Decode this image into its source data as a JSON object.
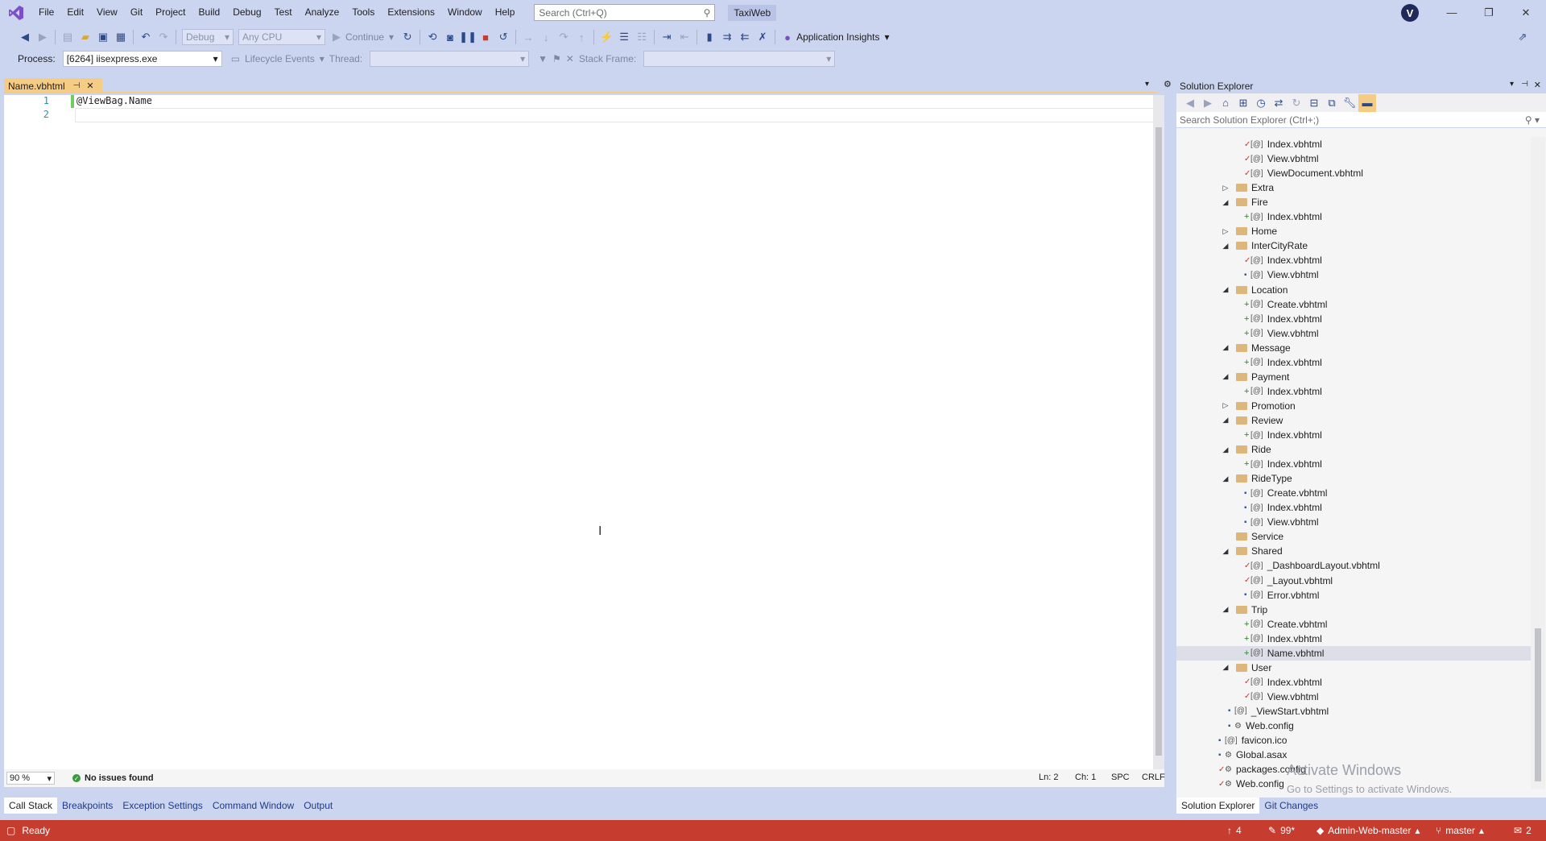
{
  "menubar": {
    "items": [
      "File",
      "Edit",
      "View",
      "Git",
      "Project",
      "Build",
      "Debug",
      "Test",
      "Analyze",
      "Tools",
      "Extensions",
      "Window",
      "Help"
    ],
    "search_placeholder": "Search (Ctrl+Q)",
    "solution_name": "TaxiWeb",
    "avatar_letter": "V"
  },
  "toolbar": {
    "config": "Debug",
    "platform": "Any CPU",
    "continue_label": "Continue",
    "app_insights_label": "Application Insights",
    "process_label": "Process:",
    "process_value": "[6264] iisexpress.exe",
    "lifecycle_label": "Lifecycle Events",
    "thread_label": "Thread:",
    "stack_frame_label": "Stack Frame:"
  },
  "editor": {
    "tab_label": "Name.vbhtml",
    "lines": [
      {
        "number": "1",
        "text": "@ViewBag.Name"
      },
      {
        "number": "2",
        "text": ""
      }
    ],
    "zoom": "90 %",
    "issues": "No issues found",
    "ln": "Ln: 2",
    "ch": "Ch: 1",
    "spc": "SPC",
    "crlf": "CRLF"
  },
  "bottom_tabs": [
    "Call Stack",
    "Breakpoints",
    "Exception Settings",
    "Command Window",
    "Output"
  ],
  "solution_explorer": {
    "title": "Solution Explorer",
    "search_placeholder": "Search Solution Explorer (Ctrl+;)",
    "tree": [
      {
        "label": "Index.vbhtml",
        "type": "file",
        "level": 3,
        "state": "check"
      },
      {
        "label": "View.vbhtml",
        "type": "file",
        "level": 3,
        "state": "check"
      },
      {
        "label": "ViewDocument.vbhtml",
        "type": "file",
        "level": 3,
        "state": "check"
      },
      {
        "label": "Extra",
        "type": "folder",
        "level": 2,
        "expanded": false
      },
      {
        "label": "Fire",
        "type": "folder",
        "level": 2,
        "expanded": true
      },
      {
        "label": "Index.vbhtml",
        "type": "file",
        "level": 3,
        "state": "plus"
      },
      {
        "label": "Home",
        "type": "folder",
        "level": 2,
        "expanded": false
      },
      {
        "label": "InterCityRate",
        "type": "folder",
        "level": 2,
        "expanded": true
      },
      {
        "label": "Index.vbhtml",
        "type": "file",
        "level": 3,
        "state": "check"
      },
      {
        "label": "View.vbhtml",
        "type": "file",
        "level": 3,
        "state": "lock"
      },
      {
        "label": "Location",
        "type": "folder",
        "level": 2,
        "expanded": true
      },
      {
        "label": "Create.vbhtml",
        "type": "file",
        "level": 3,
        "state": "plus"
      },
      {
        "label": "Index.vbhtml",
        "type": "file",
        "level": 3,
        "state": "plus"
      },
      {
        "label": "View.vbhtml",
        "type": "file",
        "level": 3,
        "state": "plus"
      },
      {
        "label": "Message",
        "type": "folder",
        "level": 2,
        "expanded": true
      },
      {
        "label": "Index.vbhtml",
        "type": "file",
        "level": 3,
        "state": "plus"
      },
      {
        "label": "Payment",
        "type": "folder",
        "level": 2,
        "expanded": true
      },
      {
        "label": "Index.vbhtml",
        "type": "file",
        "level": 3,
        "state": "plus"
      },
      {
        "label": "Promotion",
        "type": "folder",
        "level": 2,
        "expanded": false
      },
      {
        "label": "Review",
        "type": "folder",
        "level": 2,
        "expanded": true
      },
      {
        "label": "Index.vbhtml",
        "type": "file",
        "level": 3,
        "state": "plus"
      },
      {
        "label": "Ride",
        "type": "folder",
        "level": 2,
        "expanded": true
      },
      {
        "label": "Index.vbhtml",
        "type": "file",
        "level": 3,
        "state": "plus"
      },
      {
        "label": "RideType",
        "type": "folder",
        "level": 2,
        "expanded": true
      },
      {
        "label": "Create.vbhtml",
        "type": "file",
        "level": 3,
        "state": "lock"
      },
      {
        "label": "Index.vbhtml",
        "type": "file",
        "level": 3,
        "state": "lock"
      },
      {
        "label": "View.vbhtml",
        "type": "file",
        "level": 3,
        "state": "lock"
      },
      {
        "label": "Service",
        "type": "folder",
        "level": 2,
        "expanded": null
      },
      {
        "label": "Shared",
        "type": "folder",
        "level": 2,
        "expanded": true
      },
      {
        "label": "_DashboardLayout.vbhtml",
        "type": "file",
        "level": 3,
        "state": "check"
      },
      {
        "label": "_Layout.vbhtml",
        "type": "file",
        "level": 3,
        "state": "check"
      },
      {
        "label": "Error.vbhtml",
        "type": "file",
        "level": 3,
        "state": "lock"
      },
      {
        "label": "Trip",
        "type": "folder",
        "level": 2,
        "expanded": true
      },
      {
        "label": "Create.vbhtml",
        "type": "file",
        "level": 3,
        "state": "plus"
      },
      {
        "label": "Index.vbhtml",
        "type": "file",
        "level": 3,
        "state": "plus"
      },
      {
        "label": "Name.vbhtml",
        "type": "file",
        "level": 3,
        "state": "plus",
        "selected": true
      },
      {
        "label": "User",
        "type": "folder",
        "level": 2,
        "expanded": true
      },
      {
        "label": "Index.vbhtml",
        "type": "file",
        "level": 3,
        "state": "check"
      },
      {
        "label": "View.vbhtml",
        "type": "file",
        "level": 3,
        "state": "check"
      },
      {
        "label": "_ViewStart.vbhtml",
        "type": "file",
        "level": 2,
        "state": "lock"
      },
      {
        "label": "Web.config",
        "type": "config",
        "level": 2,
        "state": "lock"
      },
      {
        "label": "favicon.ico",
        "type": "file",
        "level": 1,
        "state": "lock"
      },
      {
        "label": "Global.asax",
        "type": "config",
        "level": 1,
        "state": "lock"
      },
      {
        "label": "packages.config",
        "type": "config",
        "level": 1,
        "state": "check"
      },
      {
        "label": "Web.config",
        "type": "config",
        "level": 1,
        "state": "check"
      }
    ],
    "tabs": [
      "Solution Explorer",
      "Git Changes"
    ]
  },
  "watermark": {
    "line1": "Activate Windows",
    "line2": "Go to Settings to activate Windows."
  },
  "statusbar": {
    "ready": "Ready",
    "up_count": "4",
    "pencil_count": "99*",
    "repo": "Admin-Web-master",
    "branch": "master",
    "notifications": "2"
  }
}
